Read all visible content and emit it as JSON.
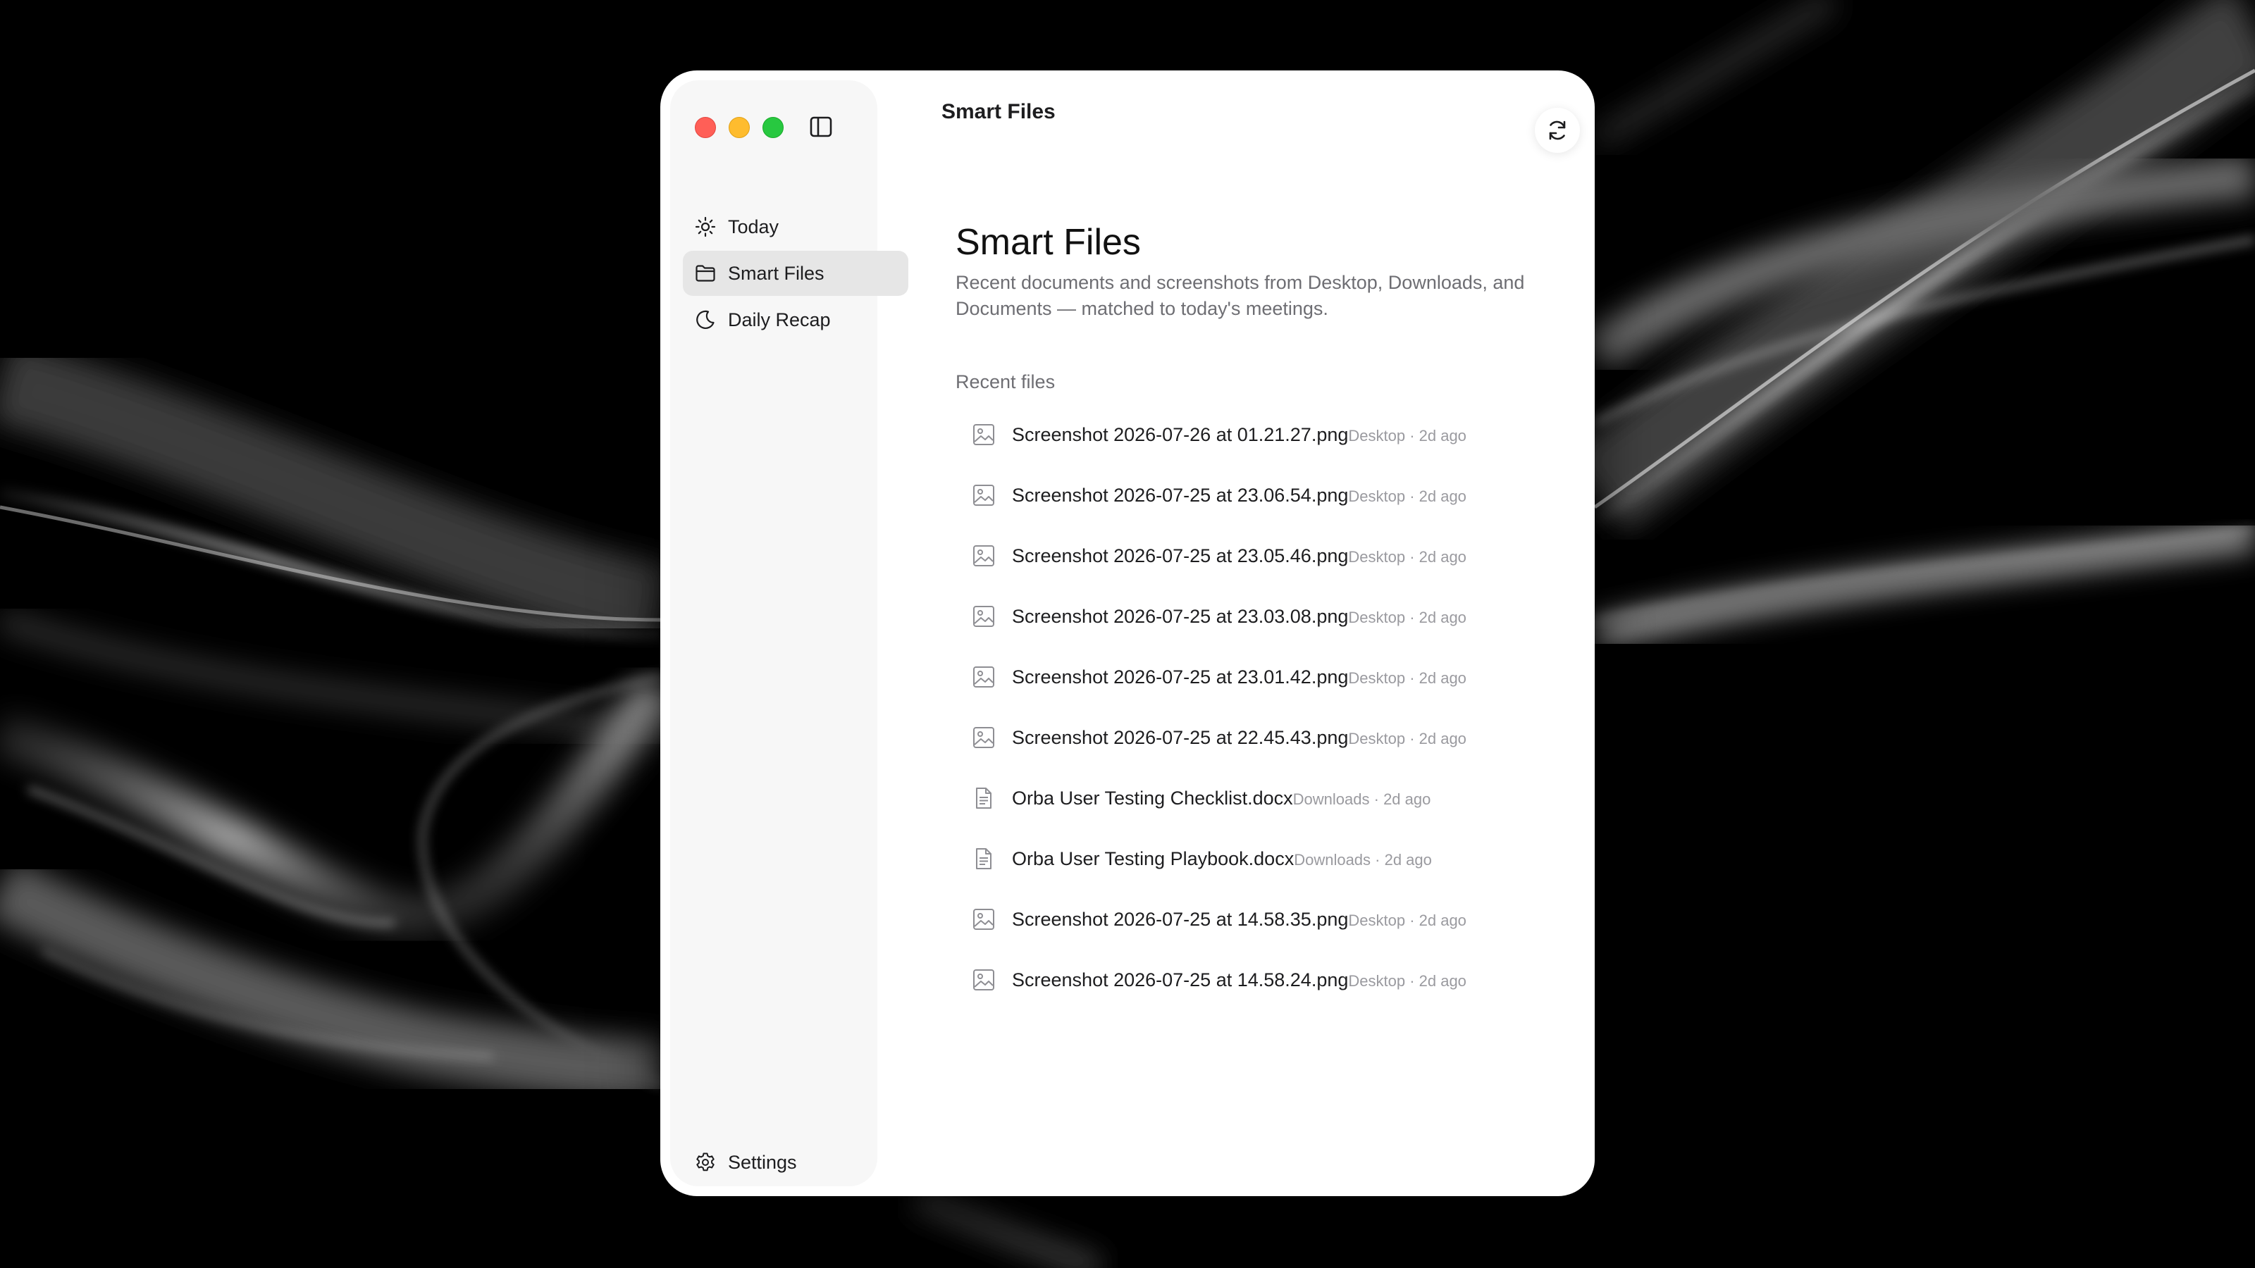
{
  "header": {
    "title": "Smart Files"
  },
  "sidebar": {
    "items": [
      {
        "label": "Today",
        "icon": "sun-icon"
      },
      {
        "label": "Smart Files",
        "icon": "folder-icon"
      },
      {
        "label": "Daily Recap",
        "icon": "moon-icon"
      }
    ],
    "settings_label": "Settings"
  },
  "main": {
    "title": "Smart Files",
    "description": "Recent documents and screenshots from Desktop, Downloads, and Documents — matched to today's meetings.",
    "section_label": "Recent files",
    "files": [
      {
        "name": "Screenshot 2026-07-26 at 01.21.27.png",
        "meta": "Desktop · 2d ago",
        "kind": "image"
      },
      {
        "name": "Screenshot 2026-07-25 at 23.06.54.png",
        "meta": "Desktop · 2d ago",
        "kind": "image"
      },
      {
        "name": "Screenshot 2026-07-25 at 23.05.46.png",
        "meta": "Desktop · 2d ago",
        "kind": "image"
      },
      {
        "name": "Screenshot 2026-07-25 at 23.03.08.png",
        "meta": "Desktop · 2d ago",
        "kind": "image"
      },
      {
        "name": "Screenshot 2026-07-25 at 23.01.42.png",
        "meta": "Desktop · 2d ago",
        "kind": "image"
      },
      {
        "name": "Screenshot 2026-07-25 at 22.45.43.png",
        "meta": "Desktop · 2d ago",
        "kind": "image"
      },
      {
        "name": "Orba User Testing Checklist.docx",
        "meta": "Downloads · 2d ago",
        "kind": "document"
      },
      {
        "name": "Orba User Testing Playbook.docx",
        "meta": "Downloads · 2d ago",
        "kind": "document"
      },
      {
        "name": "Screenshot 2026-07-25 at 14.58.35.png",
        "meta": "Desktop · 2d ago",
        "kind": "image"
      },
      {
        "name": "Screenshot 2026-07-25 at 14.58.24.png",
        "meta": "Desktop · 2d ago",
        "kind": "image"
      }
    ]
  },
  "colors": {
    "window_bg": "#ffffff",
    "sidebar_bg": "#f7f7f7",
    "active_item_bg": "#e6e6e6",
    "text_primary": "#1d1d1f",
    "text_secondary": "#6e6e73",
    "text_meta": "#9a9a9f",
    "traffic_red": "#ff5f57",
    "traffic_yellow": "#febc2e",
    "traffic_green": "#28c840"
  }
}
